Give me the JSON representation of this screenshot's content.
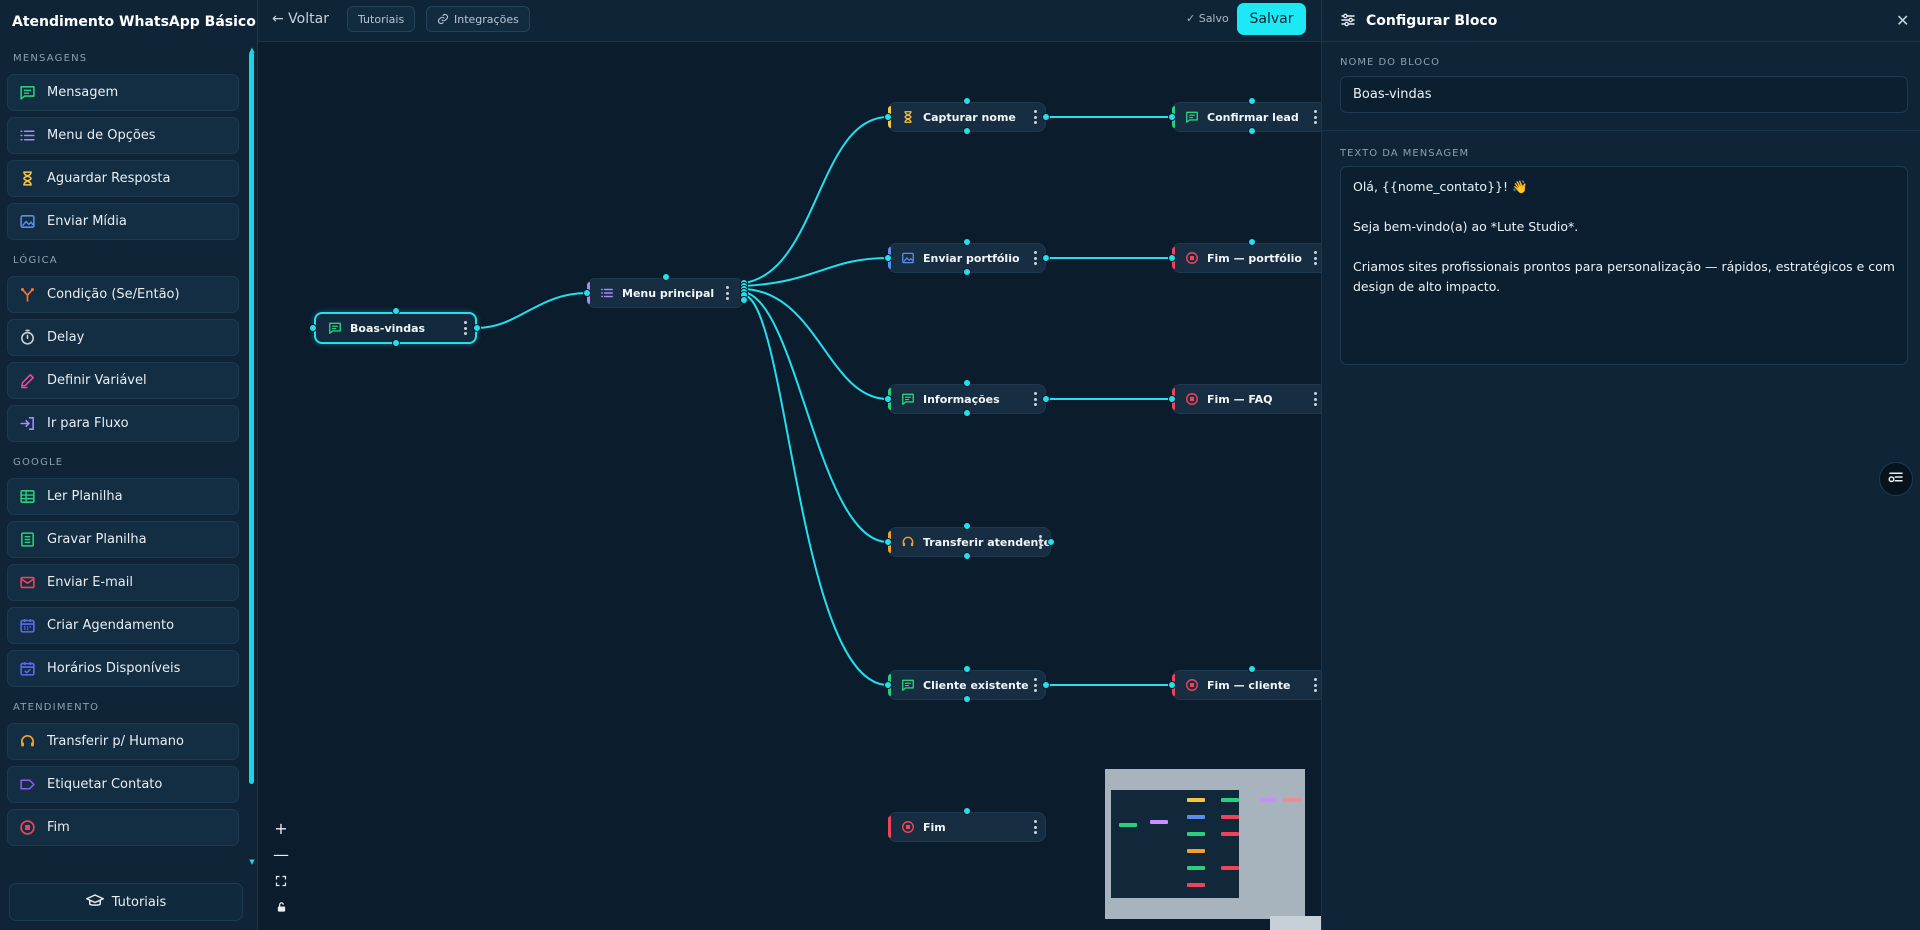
{
  "app": {
    "title": "Atendimento WhatsApp Básico"
  },
  "sidebar": {
    "sections": [
      {
        "title": "MENSAGENS",
        "items": [
          {
            "label": "Mensagem",
            "icon": "message-icon",
            "color": "#28d07c"
          },
          {
            "label": "Menu de Opções",
            "icon": "list-icon",
            "color": "#a78bfa"
          },
          {
            "label": "Aguardar Resposta",
            "icon": "hourglass-icon",
            "color": "#f5c542"
          },
          {
            "label": "Enviar Mídia",
            "icon": "image-icon",
            "color": "#5b8def"
          }
        ]
      },
      {
        "title": "LÓGICA",
        "items": [
          {
            "label": "Condição (Se/Então)",
            "icon": "branch-icon",
            "color": "#f4733a"
          },
          {
            "label": "Delay",
            "icon": "timer-icon",
            "color": "#c9d3dc"
          },
          {
            "label": "Definir Variável",
            "icon": "pencil-icon",
            "color": "#ec4899"
          },
          {
            "label": "Ir para Fluxo",
            "icon": "login-icon",
            "color": "#a78bfa"
          }
        ]
      },
      {
        "title": "GOOGLE",
        "items": [
          {
            "label": "Ler Planilha",
            "icon": "table-icon",
            "color": "#28d07c"
          },
          {
            "label": "Gravar Planilha",
            "icon": "sheet-icon",
            "color": "#28d07c"
          },
          {
            "label": "Enviar E-mail",
            "icon": "mail-icon",
            "color": "#f0435a"
          },
          {
            "label": "Criar Agendamento",
            "icon": "calendar-icon",
            "color": "#5b6cf0"
          },
          {
            "label": "Horários Disponíveis",
            "icon": "calendar-check-icon",
            "color": "#5b6cf0"
          }
        ]
      },
      {
        "title": "ATENDIMENTO",
        "items": [
          {
            "label": "Transferir p/ Humano",
            "icon": "headset-icon",
            "color": "#f59e2c"
          },
          {
            "label": "Etiquetar Contato",
            "icon": "tag-icon",
            "color": "#8b5cf6"
          },
          {
            "label": "Fim",
            "icon": "stop-icon",
            "color": "#f0435a"
          }
        ]
      }
    ],
    "footer_label": "Tutoriais"
  },
  "topbar": {
    "back_label": "← Voltar",
    "tutorials_label": "Tutoriais",
    "integrations_label": "Integrações",
    "saved_label": "✓ Salvo",
    "save_label": "Salvar"
  },
  "canvas": {
    "nodes": [
      {
        "id": "boas",
        "label": "Boas-vindas",
        "icon": "message-icon",
        "color": "#28d07c",
        "selected": true
      },
      {
        "id": "menu",
        "label": "Menu principal",
        "icon": "list-icon",
        "color": "#a78bfa"
      },
      {
        "id": "capt",
        "label": "Capturar nome",
        "icon": "hourglass-icon",
        "color": "#f5c542"
      },
      {
        "id": "conf",
        "label": "Confirmar lead",
        "icon": "message-icon",
        "color": "#28d07c"
      },
      {
        "id": "port",
        "label": "Enviar portfólio",
        "icon": "image-icon",
        "color": "#5b8def"
      },
      {
        "id": "fimp",
        "label": "Fim — portfólio",
        "icon": "stop-icon",
        "color": "#f0435a"
      },
      {
        "id": "info",
        "label": "Informações",
        "icon": "message-icon",
        "color": "#28d07c"
      },
      {
        "id": "fimf",
        "label": "Fim — FAQ",
        "icon": "stop-icon",
        "color": "#f0435a"
      },
      {
        "id": "trans",
        "label": "Transferir atendente",
        "icon": "headset-icon",
        "color": "#f59e2c"
      },
      {
        "id": "cli",
        "label": "Cliente existente",
        "icon": "message-icon",
        "color": "#28d07c"
      },
      {
        "id": "fimc",
        "label": "Fim — cliente",
        "icon": "stop-icon",
        "color": "#f0435a"
      },
      {
        "id": "fim",
        "label": "Fim",
        "icon": "stop-icon",
        "color": "#f0435a"
      }
    ],
    "accent": "#22e0ee"
  },
  "panel": {
    "title": "Configurar Bloco",
    "name_label": "NOME DO BLOCO",
    "name_value": "Boas-vindas",
    "message_label": "TEXTO DA MENSAGEM",
    "message_value": "Olá, {{nome_contato}}! 👋\n\nSeja bem-vindo(a) ao *Lute Studio*.\n\nCriamos sites profissionais prontos para personalização — rápidos, estratégicos e com design de alto impacto."
  }
}
